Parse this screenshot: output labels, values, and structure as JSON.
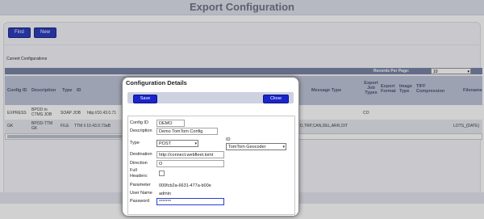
{
  "header": {
    "title": "Export Configuration"
  },
  "toolbar": {
    "find_label": "Find",
    "new_label": "New"
  },
  "section": {
    "title": "Current Configurations"
  },
  "records_per_page": {
    "label": "Records Per Page:",
    "value": "10"
  },
  "columns": [
    "Config ID",
    "Description",
    "Type",
    "ID",
    "Message Type",
    "Export Job Types",
    "Export Format",
    "Image Type",
    "TIFF Compression",
    "Filename"
  ],
  "rows": [
    {
      "config_id": "EXPRESS",
      "description": "BPOD to CTMS JOB",
      "type": "SOAP JOB",
      "id": "http://10.43.0.71",
      "message_type": "",
      "job_types": "CO",
      "filename": ""
    },
    {
      "config_id": "GK",
      "description": "BPOD-TTM GK",
      "type": "FILE",
      "id": "TTM li 10.43.0.73aB",
      "message_type": "RO,TRP,CAN,DEL,ARR,OIT",
      "job_types": "",
      "filename": "LOTS_{DATE}"
    }
  ],
  "modal": {
    "title": "Configuration Details",
    "save_label": "Save",
    "close_label": "Close",
    "fields": {
      "config_id": {
        "label": "Config ID",
        "value": "DEMO"
      },
      "description": {
        "label": "Description",
        "value": "Demo TomTom Config"
      },
      "type": {
        "label": "Type",
        "value": "POST"
      },
      "id": {
        "label": "ID",
        "value": "TomTom Geocoder"
      },
      "destination": {
        "label": "Destination",
        "value": "http://connect.webfleet.tomt"
      },
      "direction": {
        "label": "Direction",
        "value": "O"
      },
      "full_headers": {
        "label_line1": "Full",
        "label_line2": "Headers:"
      },
      "parameter": {
        "label": "Parameter",
        "value": "000fcb2a-6631-477a-b00e"
      },
      "user_name": {
        "label": "User Name",
        "value": "admin"
      },
      "password": {
        "label": "Password",
        "value": "*******"
      }
    }
  }
}
